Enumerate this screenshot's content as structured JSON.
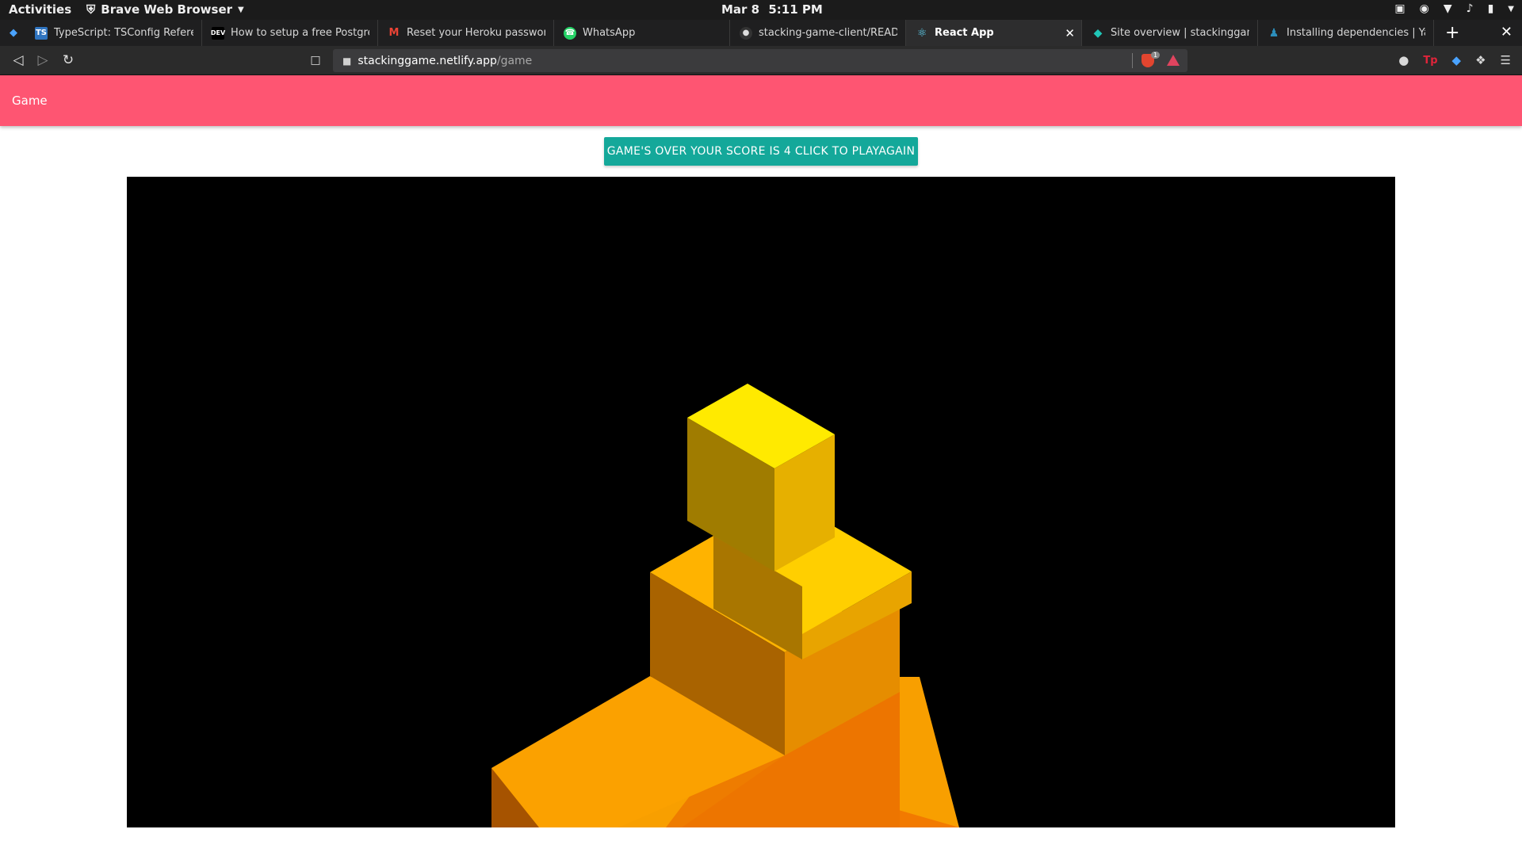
{
  "os": {
    "activities": "Activities",
    "app_menu": "Brave Web Browser",
    "date": "Mar 8",
    "time": "5:11 PM",
    "tray_icons": [
      "screen-icon",
      "discord-icon",
      "wifi-icon",
      "volume-icon",
      "battery-icon",
      "menu-arrow-icon"
    ]
  },
  "browser": {
    "tabs": [
      {
        "label": "TypeScript: TSConfig Reference",
        "icon": "ts-icon",
        "active": false
      },
      {
        "label": "How to setup a free PostgreSQL",
        "icon": "dev-icon",
        "active": false
      },
      {
        "label": "Reset your Heroku password -",
        "icon": "gmail-icon",
        "active": false
      },
      {
        "label": "WhatsApp",
        "icon": "whatsapp-icon",
        "active": false
      },
      {
        "label": "stacking-game-client/README",
        "icon": "github-icon",
        "active": false
      },
      {
        "label": "React App",
        "icon": "react-icon",
        "active": true
      },
      {
        "label": "Site overview | stackinggame",
        "icon": "netlify-icon",
        "active": false
      },
      {
        "label": "Installing dependencies | Yarn",
        "icon": "yarn-icon",
        "active": false
      }
    ],
    "url_host": "stackinggame.netlify.app",
    "url_path": "/game",
    "shield_count": "1"
  },
  "app": {
    "brand": "Game",
    "gameover_label": "GAME'S OVER YOUR SCORE IS 4 CLICK TO PLAYAGAIN"
  },
  "colors": {
    "appbar": "#fe5572",
    "button": "#14a89a",
    "canvas": "#000000"
  }
}
